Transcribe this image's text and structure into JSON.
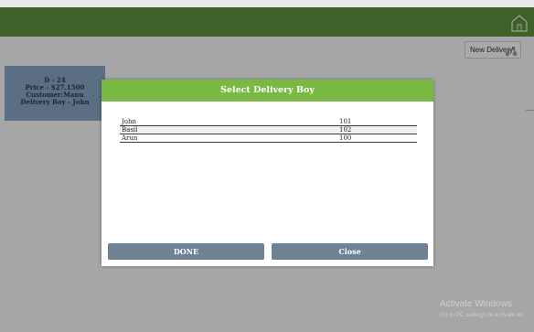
{
  "header": {
    "home_icon": "home-icon"
  },
  "toolbar": {
    "new_delivery_label": "New Delivery",
    "new_delivery_icon": "scooter-icon"
  },
  "order_card": {
    "id": "D - 24",
    "price": "Price - $27.1500",
    "customer": "Customer:Manu",
    "delivery_boy": "Delivery Boy - John"
  },
  "dialog": {
    "title": "Select Delivery Boy",
    "delivery_boys": [
      {
        "name": "John",
        "code": "101"
      },
      {
        "name": "Basil",
        "code": "102"
      },
      {
        "name": "Arun",
        "code": "100"
      }
    ],
    "done_label": "DONE",
    "close_label": "Close"
  },
  "watermark": {
    "title": "Activate Windows",
    "subtitle": "Go to PC settings to activate W"
  },
  "colors": {
    "topbar": "#3f6028",
    "dialog_header": "#78b843",
    "button": "#6e8294",
    "order_card": "#5a6f84"
  }
}
